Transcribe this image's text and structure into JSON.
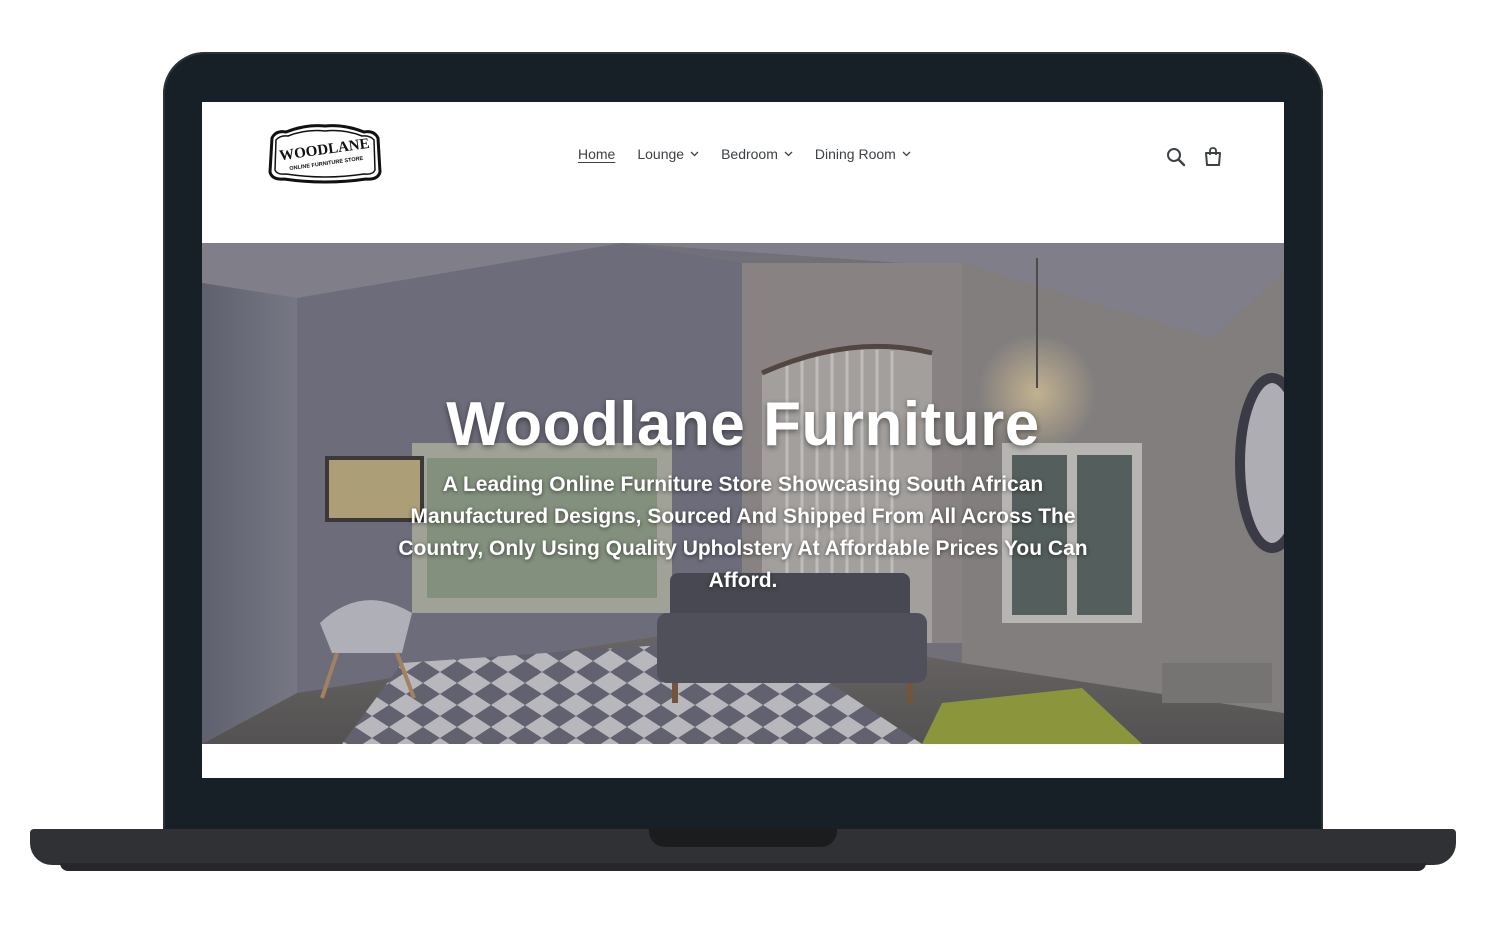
{
  "brand": {
    "logo_text": "WOODLANE",
    "logo_tagline": "ONLINE FURNITURE STORE"
  },
  "nav": {
    "items": [
      {
        "label": "Home",
        "active": true,
        "has_dropdown": false
      },
      {
        "label": "Lounge",
        "active": false,
        "has_dropdown": true
      },
      {
        "label": "Bedroom",
        "active": false,
        "has_dropdown": true
      },
      {
        "label": "Dining Room",
        "active": false,
        "has_dropdown": true
      }
    ]
  },
  "header_icons": {
    "search": "search-icon",
    "cart": "cart-icon"
  },
  "hero": {
    "title": "Woodlane Furniture",
    "subtitle": "A Leading Online Furniture Store Showcasing South African Manufactured Designs, Sourced And Shipped From All Across The Country, Only Using Quality Upholstery At Affordable Prices You Can Afford."
  },
  "colors": {
    "bezel": "#172027",
    "nav_text": "#3d4246",
    "hero_text": "#ffffff"
  }
}
